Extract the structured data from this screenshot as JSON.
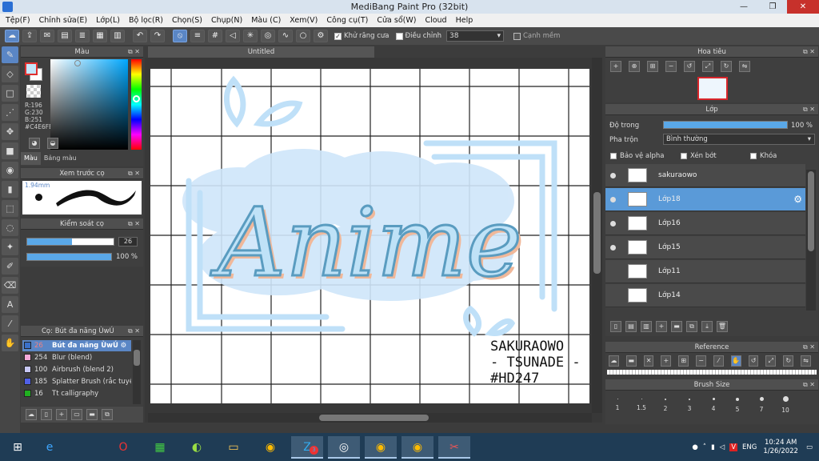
{
  "window": {
    "title": "MediBang Paint Pro (32bit)"
  },
  "menu": [
    "Tệp(F)",
    "Chỉnh sửa(E)",
    "Lớp(L)",
    "Bộ lọc(R)",
    "Chọn(S)",
    "Chụp(N)",
    "Màu (C)",
    "Xem(V)",
    "Công cụ(T)",
    "Cửa sổ(W)",
    "Cloud",
    "Help"
  ],
  "toolbar": {
    "antialias_label": "Khử răng cưa",
    "adjust_label": "Điều chỉnh",
    "adjust_value": "38",
    "sharpen_label": "Cạnh mềm"
  },
  "color_panel": {
    "title": "Màu",
    "r": "R:196",
    "g": "G:230",
    "b": "B:251",
    "hex": "#C4E6FB",
    "tab_color": "Màu",
    "tab_palette": "Bảng màu",
    "fg_color": "#C4E6FB"
  },
  "preview_panel": {
    "title": "Xem trước cọ",
    "size": "1.94mm"
  },
  "control_panel": {
    "title": "Kiểm soát cọ",
    "size_value": "26",
    "opacity_value": "100 %",
    "size_fraction": 0.52,
    "opacity_fraction": 1.0
  },
  "brush_panel": {
    "title": "Cọ: Bút đa năng ÙwÚ",
    "items": [
      {
        "num": "26",
        "name": "Bút đa năng ÙwÚ",
        "color": "#3a70c8",
        "selected": true
      },
      {
        "num": "254",
        "name": "Blur (blend)",
        "color": "#f4a8d8",
        "selected": false
      },
      {
        "num": "100",
        "name": "Airbrush (blend 2)",
        "color": "#c8c8f4",
        "selected": false
      },
      {
        "num": "185",
        "name": "Splatter Brush (rắc tuyết)",
        "color": "#5060e8",
        "selected": false
      },
      {
        "num": "16",
        "name": "Tt calligraphy",
        "color": "#20b020",
        "selected": false
      }
    ]
  },
  "document": {
    "tab": "Untitled",
    "title_text": "Anime",
    "signature_line1": "SAKURAOWO",
    "signature_line2": "- TSUNADE -",
    "signature_line3": "#HD247"
  },
  "navigator": {
    "title": "Hoa tiêu"
  },
  "layer_panel": {
    "title": "Lớp",
    "opacity_label": "Độ trong",
    "opacity_value": "100 %",
    "blend_label": "Pha trộn",
    "blend_value": "Bình thường",
    "protect_alpha": "Bảo vệ alpha",
    "clipping": "Xén bớt",
    "lock": "Khóa",
    "layers": [
      {
        "name": "sakuraowo",
        "selected": false
      },
      {
        "name": "Lớp18",
        "selected": true
      },
      {
        "name": "Lớp16",
        "selected": false
      },
      {
        "name": "Lớp15",
        "selected": false
      },
      {
        "name": "Lớp11",
        "selected": false
      },
      {
        "name": "Lớp14",
        "selected": false
      }
    ]
  },
  "reference_panel": {
    "title": "Reference"
  },
  "size_panel": {
    "title": "Brush Size",
    "sizes": [
      "1",
      "1.5",
      "2",
      "3",
      "4",
      "5",
      "7",
      "10"
    ]
  },
  "taskbar": {
    "lang": "ENG",
    "time": "10:24 AM",
    "date": "1/26/2022",
    "zalo_badge": "3"
  }
}
